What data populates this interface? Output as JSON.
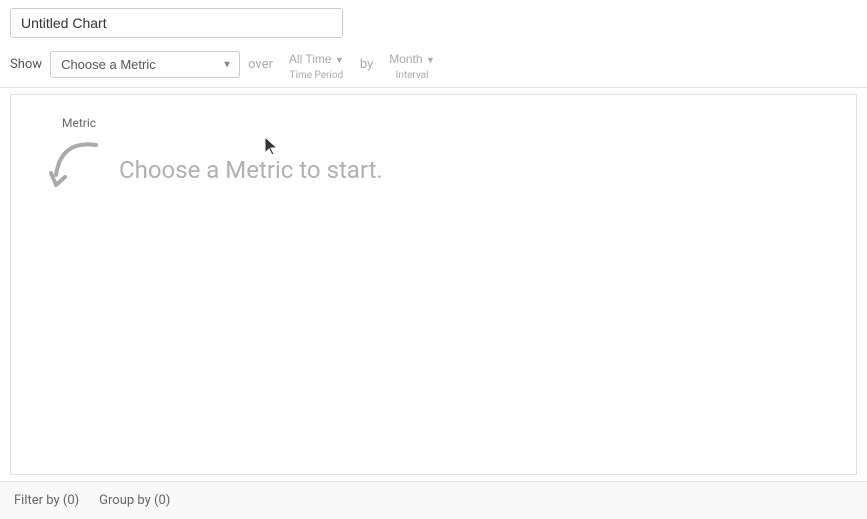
{
  "title": {
    "input_value": "Untitled Chart",
    "input_placeholder": "Untitled Chart"
  },
  "controls": {
    "show_label": "Show",
    "metric_placeholder": "Choose a Metric",
    "over_label": "over",
    "time_period_label": "All Time",
    "time_period_sub": "Time Period",
    "by_label": "by",
    "interval_label": "Month",
    "interval_sub": "Interval",
    "dropdown_hint": "Metric"
  },
  "empty_state": {
    "message": "Choose a Metric to start."
  },
  "footer": {
    "filter_label": "Filter by (0)",
    "group_label": "Group by (0)"
  }
}
